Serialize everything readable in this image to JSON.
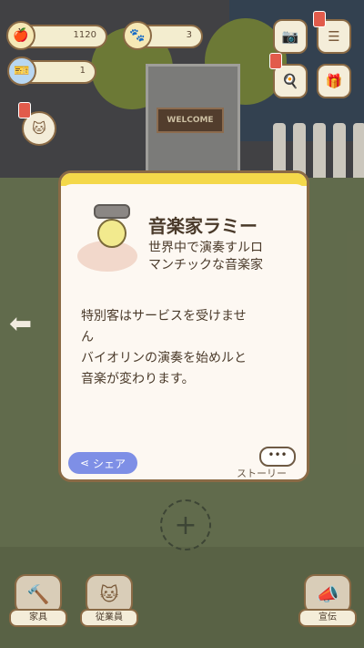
{
  "hud": {
    "coins": "1120",
    "paws": "3",
    "tickets": "1",
    "coin_icon": "apple-icon",
    "paw_icon": "paw-icon",
    "ticket_icon": "ticket-icon"
  },
  "scene": {
    "welcome_sign": "WELCOME"
  },
  "dialog": {
    "name": "音楽家ラミー",
    "desc_line1": "世界中で演奏すルロ",
    "desc_line2": "マンチックな音楽家",
    "body_line1": "特別客はサービスを受けませ",
    "body_line2": "ん",
    "body_line3": "バイオリンの演奏を始めルと",
    "body_line4": "音楽が変わります。",
    "share_label": "シェア",
    "story_dots": "•••",
    "story_label": "ストーリー"
  },
  "bottom": {
    "furniture_label": "家具",
    "staff_label": "従業員",
    "promo_label": "宣伝"
  },
  "colors": {
    "card_border": "#8a6a45",
    "card_accent": "#f4d84a",
    "share_button": "#7e8fe6"
  }
}
